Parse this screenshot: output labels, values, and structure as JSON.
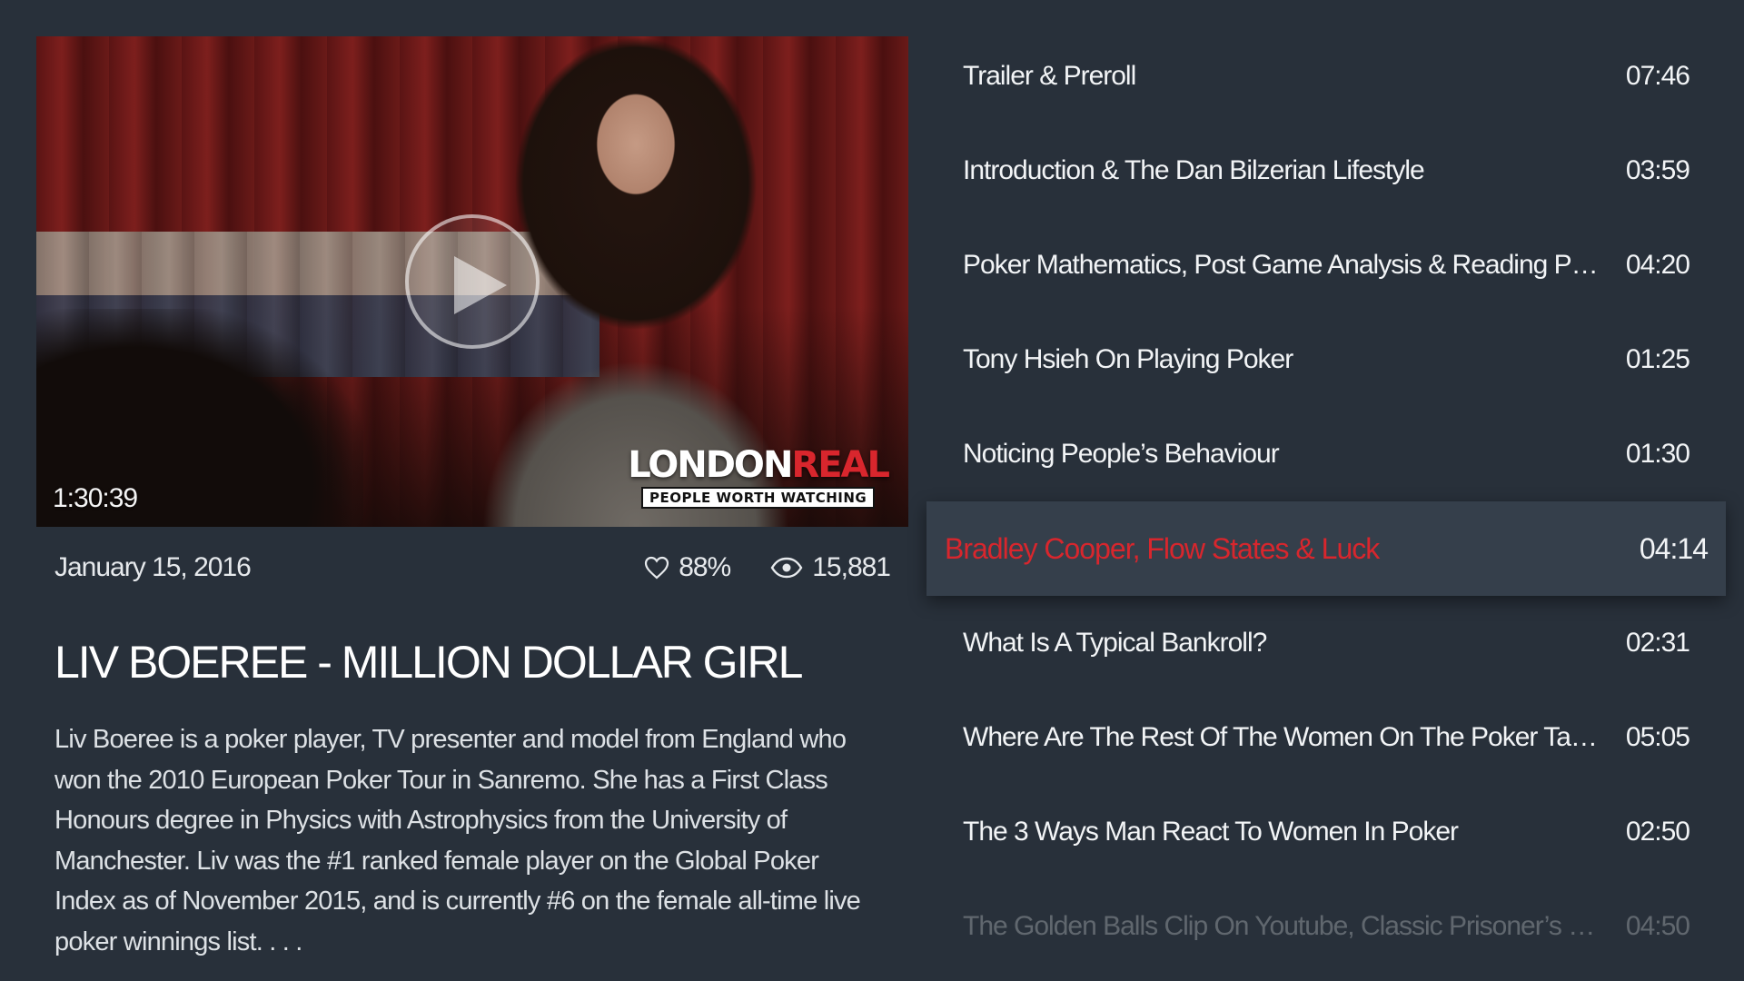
{
  "video": {
    "duration": "1:30:39",
    "brand": {
      "name_white": "LONDON",
      "name_red": "REAL",
      "tagline": "PEOPLE WORTH WATCHING"
    }
  },
  "meta": {
    "date": "January 15, 2016",
    "likes": "88%",
    "views": "15,881"
  },
  "episode": {
    "title": "LIV BOEREE - MILLION DOLLAR GIRL",
    "description": "Liv Boeree is a poker player, TV presenter and model from England who won the 2010 European Poker Tour in Sanremo. She has a First Class Honours degree in Physics with Astrophysics from the University of Manchester. Liv was the #1 ranked female player on the Global Poker Index as of November 2015, and is currently #6 on the female all-time live poker winnings list. . . ."
  },
  "chapters": [
    {
      "label": "Trailer & Preroll",
      "time": "07:46"
    },
    {
      "label": "Introduction & The Dan Bilzerian Lifestyle",
      "time": "03:59"
    },
    {
      "label": "Poker Mathematics, Post Game Analysis & Reading Poker Players",
      "time": "04:20"
    },
    {
      "label": "Tony Hsieh On Playing Poker",
      "time": "01:25"
    },
    {
      "label": "Noticing People’s Behaviour",
      "time": "01:30"
    },
    {
      "label": "Bradley Cooper, Flow States & Luck",
      "time": "04:14"
    },
    {
      "label": "What Is A Typical Bankroll?",
      "time": "02:31"
    },
    {
      "label": "Where Are The Rest Of The Women On The Poker Table?",
      "time": "05:05"
    },
    {
      "label": "The 3 Ways Man React To Women In Poker",
      "time": "02:50"
    },
    {
      "label": "The Golden Balls Clip On Youtube, Classic Prisoner’s Dilemma & Ga...",
      "time": "04:50"
    }
  ],
  "colors": {
    "background": "#28303a",
    "accent": "#d8262d",
    "selected_row": "#353f4b"
  }
}
